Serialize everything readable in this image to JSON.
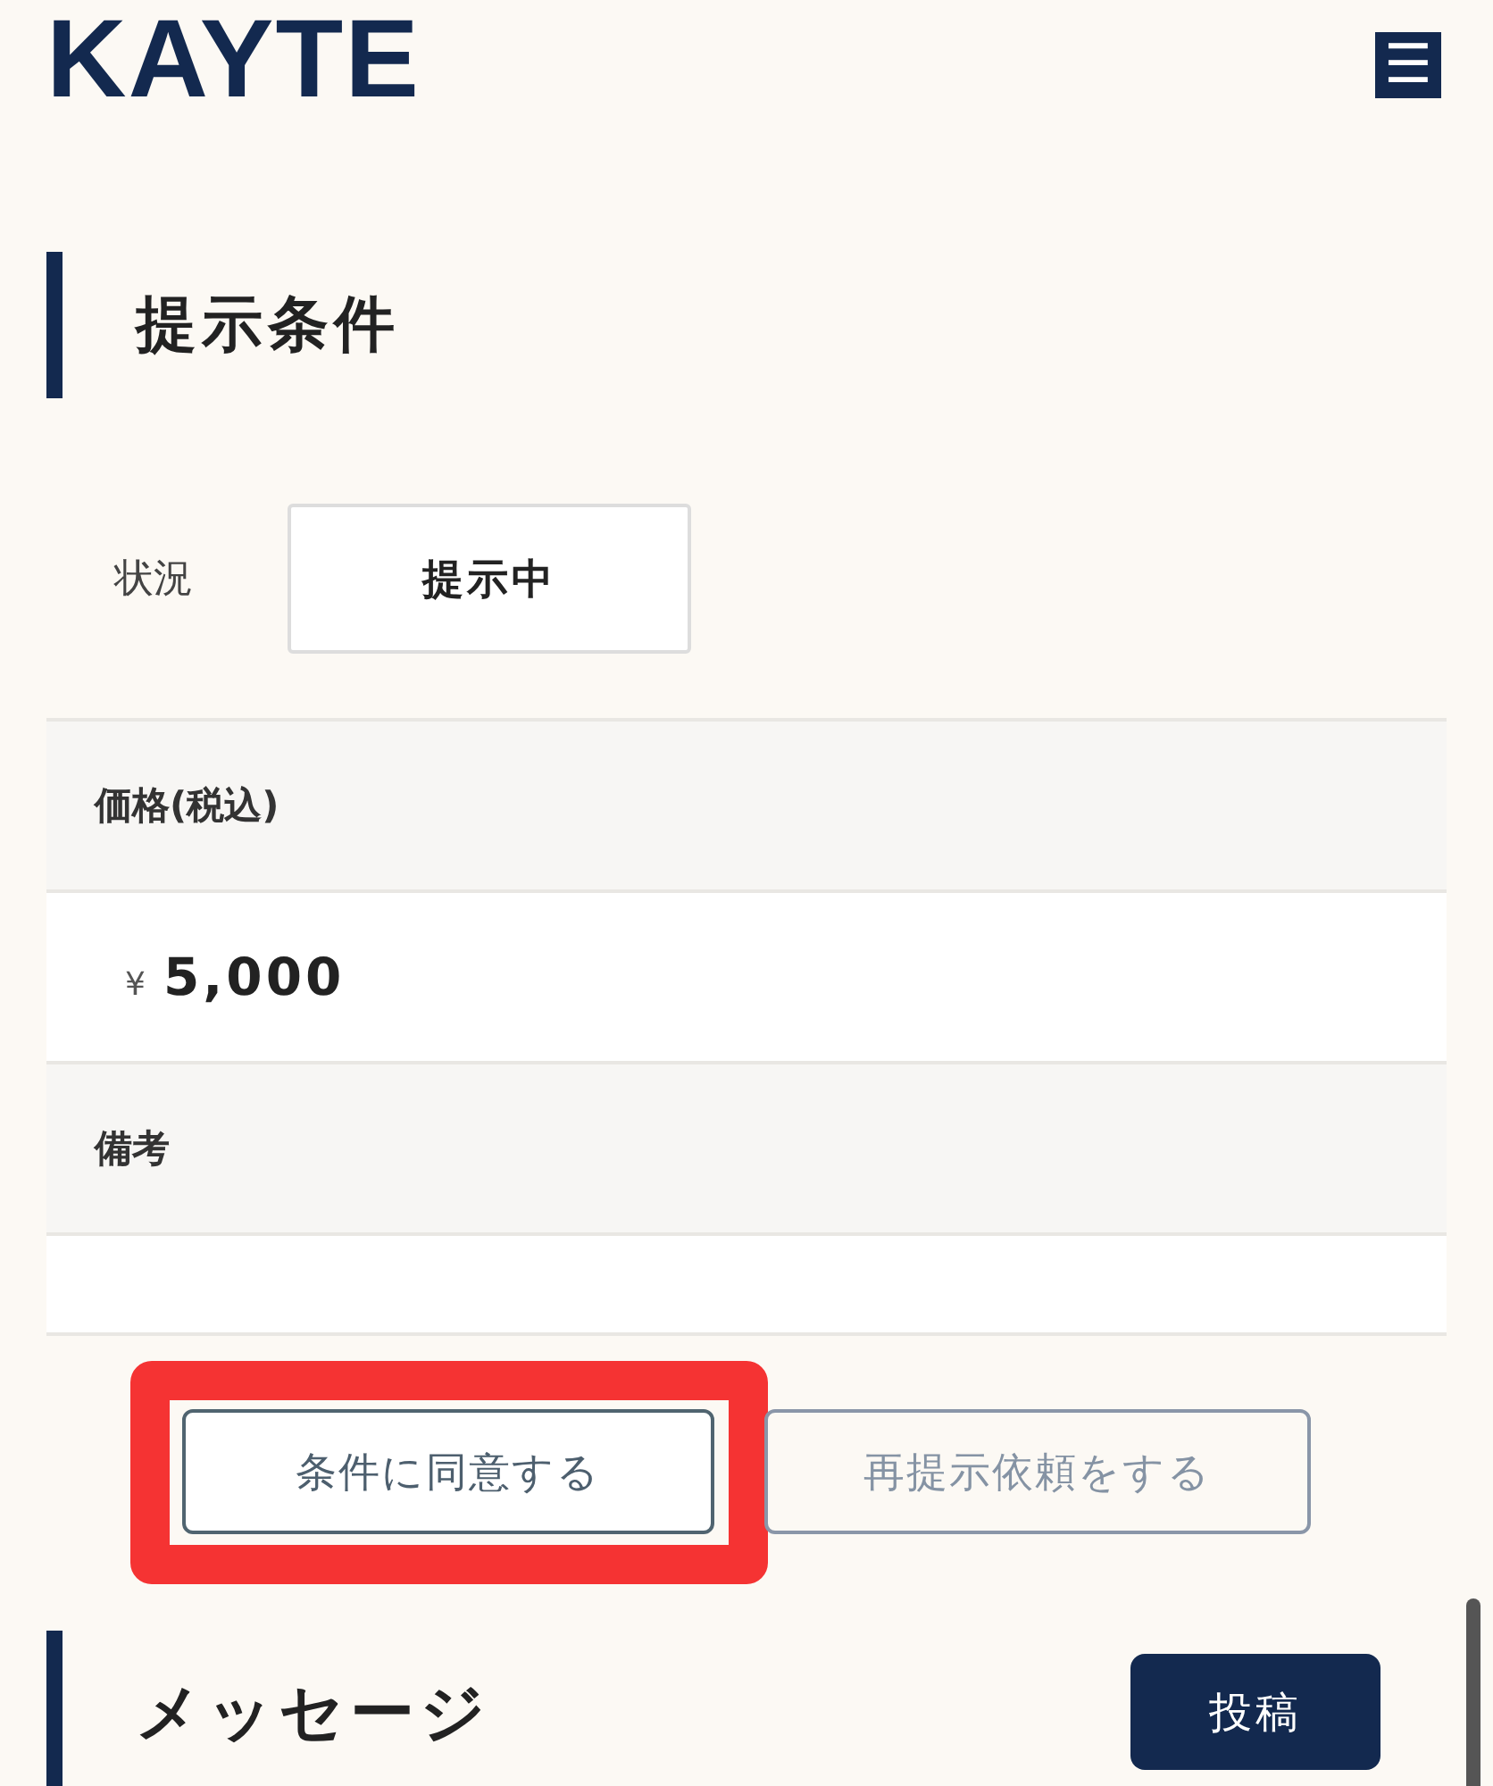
{
  "header": {
    "logo": "KAYTE",
    "menu_icon": "☰"
  },
  "offer": {
    "title": "提示条件",
    "status": {
      "label": "状況",
      "value": "提示中"
    },
    "fields": [
      {
        "label": "価格(税込)",
        "currency": "¥",
        "amount": "5,000"
      },
      {
        "label": "備考"
      }
    ],
    "actions": [
      {
        "label": "条件に同意する",
        "kind": "primary",
        "highlighted": true
      },
      {
        "label": "再提示依頼をする",
        "kind": "secondary",
        "highlighted": false
      }
    ]
  },
  "messages": {
    "title": "メッセージ",
    "post_button": "投稿"
  }
}
